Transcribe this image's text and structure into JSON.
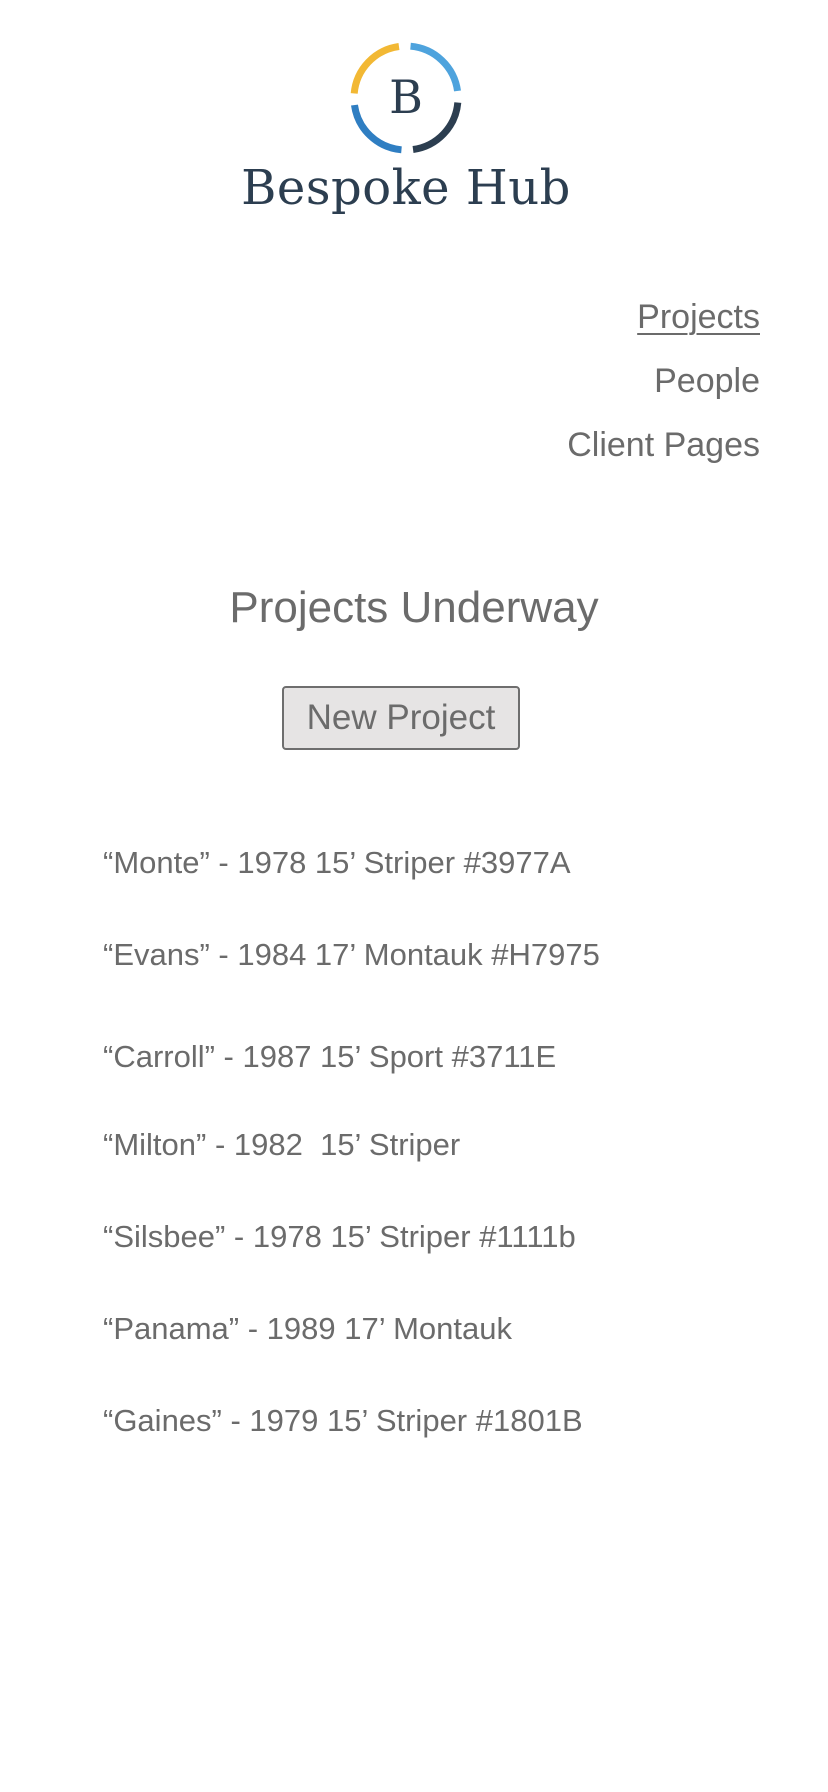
{
  "brand": {
    "logo_letter": "B",
    "name": "Bespoke Hub",
    "colors": {
      "ring_yellow": "#f2b834",
      "ring_light_blue": "#4ea3dd",
      "ring_blue": "#2f7ec2",
      "ring_dark": "#2c3e50"
    }
  },
  "nav": {
    "items": [
      {
        "label": "Projects",
        "active": true
      },
      {
        "label": "People",
        "active": false
      },
      {
        "label": "Client Pages",
        "active": false
      }
    ]
  },
  "main": {
    "title": "Projects Underway",
    "new_project_label": "New Project",
    "projects": [
      "“Monte” - 1978 15’ Striper #3977A",
      "“Evans” - 1984 17’ Montauk #H7975",
      "“Carroll” - 1987 15’ Sport #3711E",
      "“Milton” - 1982  15’ Striper",
      "“Silsbee” - 1978 15’ Striper #1111b",
      "“Panama” - 1989 17’ Montauk",
      "“Gaines” - 1979 15’ Striper #1801B"
    ]
  }
}
